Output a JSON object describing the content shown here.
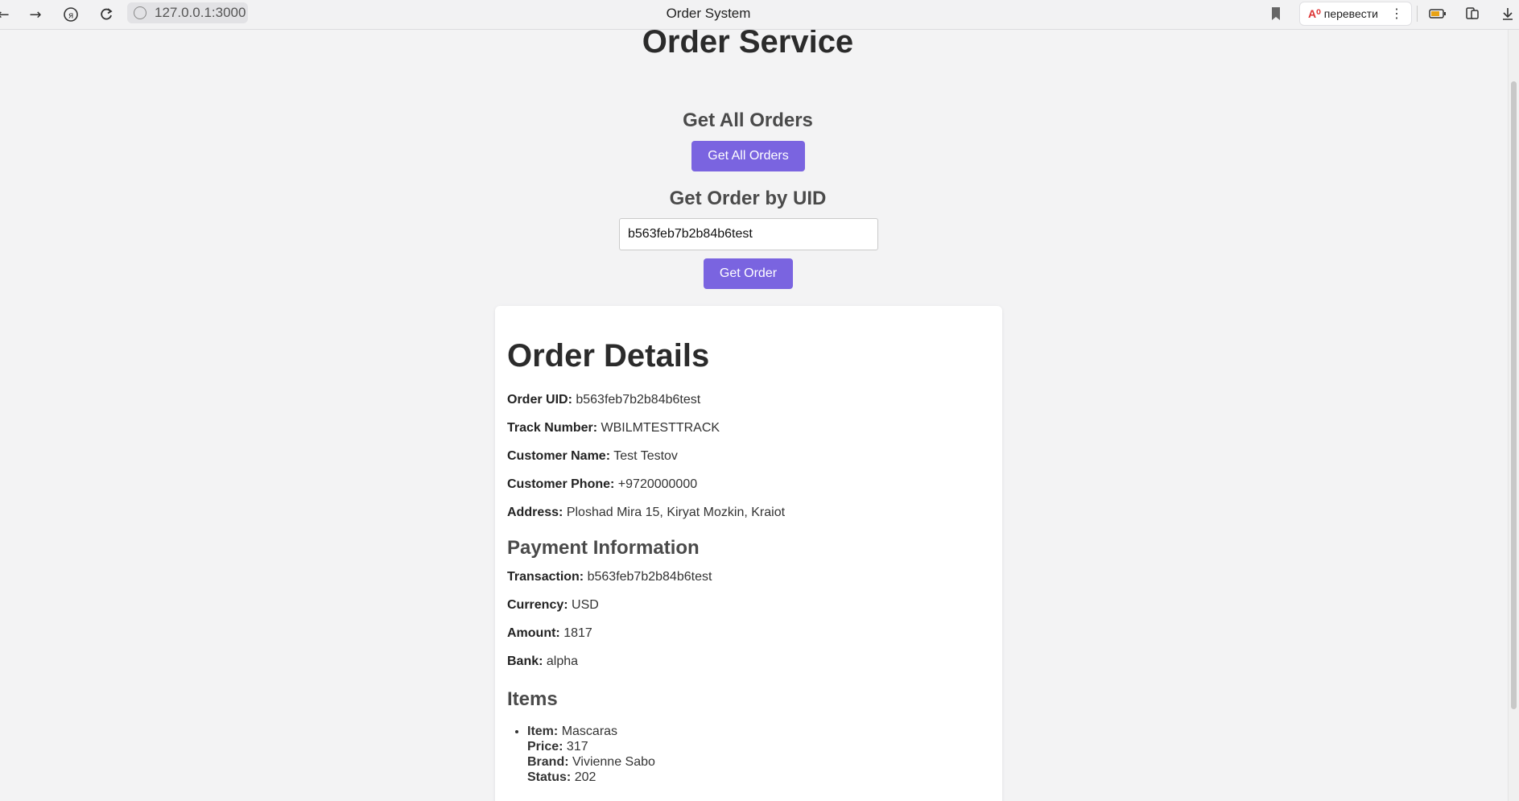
{
  "browser": {
    "url": "127.0.0.1:3000",
    "tab_title": "Order System",
    "translate_label": "перевести"
  },
  "page": {
    "title": "Order Service",
    "get_all": {
      "heading": "Get All Orders",
      "button_label": "Get All Orders"
    },
    "get_by_uid": {
      "heading": "Get Order by UID",
      "input_value": "b563feb7b2b84b6test",
      "button_label": "Get Order"
    }
  },
  "order": {
    "heading": "Order Details",
    "fields": [
      {
        "label": "Order UID:",
        "value": "b563feb7b2b84b6test"
      },
      {
        "label": "Track Number:",
        "value": "WBILMTESTTRACK"
      },
      {
        "label": "Customer Name:",
        "value": "Test Testov"
      },
      {
        "label": "Customer Phone:",
        "value": "+9720000000"
      },
      {
        "label": "Address:",
        "value": "Ploshad Mira 15, Kiryat Mozkin, Kraiot"
      }
    ],
    "payment": {
      "heading": "Payment Information",
      "fields": [
        {
          "label": "Transaction:",
          "value": "b563feb7b2b84b6test"
        },
        {
          "label": "Currency:",
          "value": "USD"
        },
        {
          "label": "Amount:",
          "value": "1817"
        },
        {
          "label": "Bank:",
          "value": "alpha"
        }
      ]
    },
    "items": {
      "heading": "Items",
      "list": [
        {
          "item_label": "Item:",
          "item": "Mascaras",
          "price_label": "Price:",
          "price": "317",
          "brand_label": "Brand:",
          "brand": "Vivienne Sabo",
          "status_label": "Status:",
          "status": "202"
        }
      ]
    }
  },
  "colors": {
    "accent": "#7a64e0",
    "background": "#f3f3f4"
  }
}
